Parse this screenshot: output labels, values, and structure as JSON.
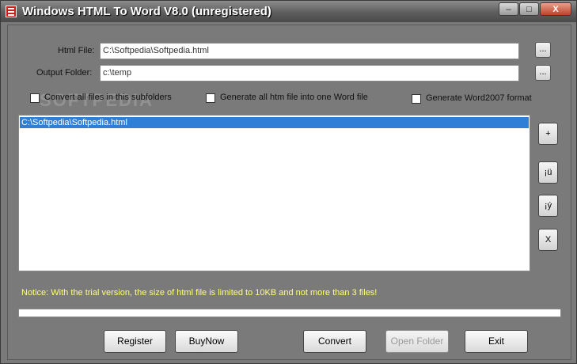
{
  "window": {
    "title": "Windows HTML To  Word V8.0 (unregistered)",
    "controls": {
      "minimize": "–",
      "maximize": "□",
      "close": "X"
    }
  },
  "form": {
    "html_file_label": "Html File:",
    "html_file_value": "C:\\Softpedia\\Softpedia.html",
    "output_folder_label": "Output Folder:",
    "output_folder_value": "c:\\temp",
    "browse_label": "..."
  },
  "options": {
    "convert_subfolders": "Convert all files in this subfolders",
    "one_word_file": "Generate all htm file into one Word file",
    "word2007": "Generate Word2007 format"
  },
  "file_list": [
    "C:\\Softpedia\\Softpedia.html"
  ],
  "side_buttons": {
    "add": "+",
    "up": "¡ü",
    "down": "¡ý",
    "remove": "X"
  },
  "notice": "Notice: With the trial version, the size of html file is limited to 10KB and not more than 3 files!",
  "buttons": {
    "register": "Register",
    "buynow": "BuyNow",
    "convert": "Convert",
    "open_folder": "Open Folder",
    "exit": "Exit"
  },
  "watermark": "SOFTPEDIA",
  "colors": {
    "notice": "#ffff7a",
    "selection": "#2f7fd6",
    "close_button": "#c0402a"
  }
}
